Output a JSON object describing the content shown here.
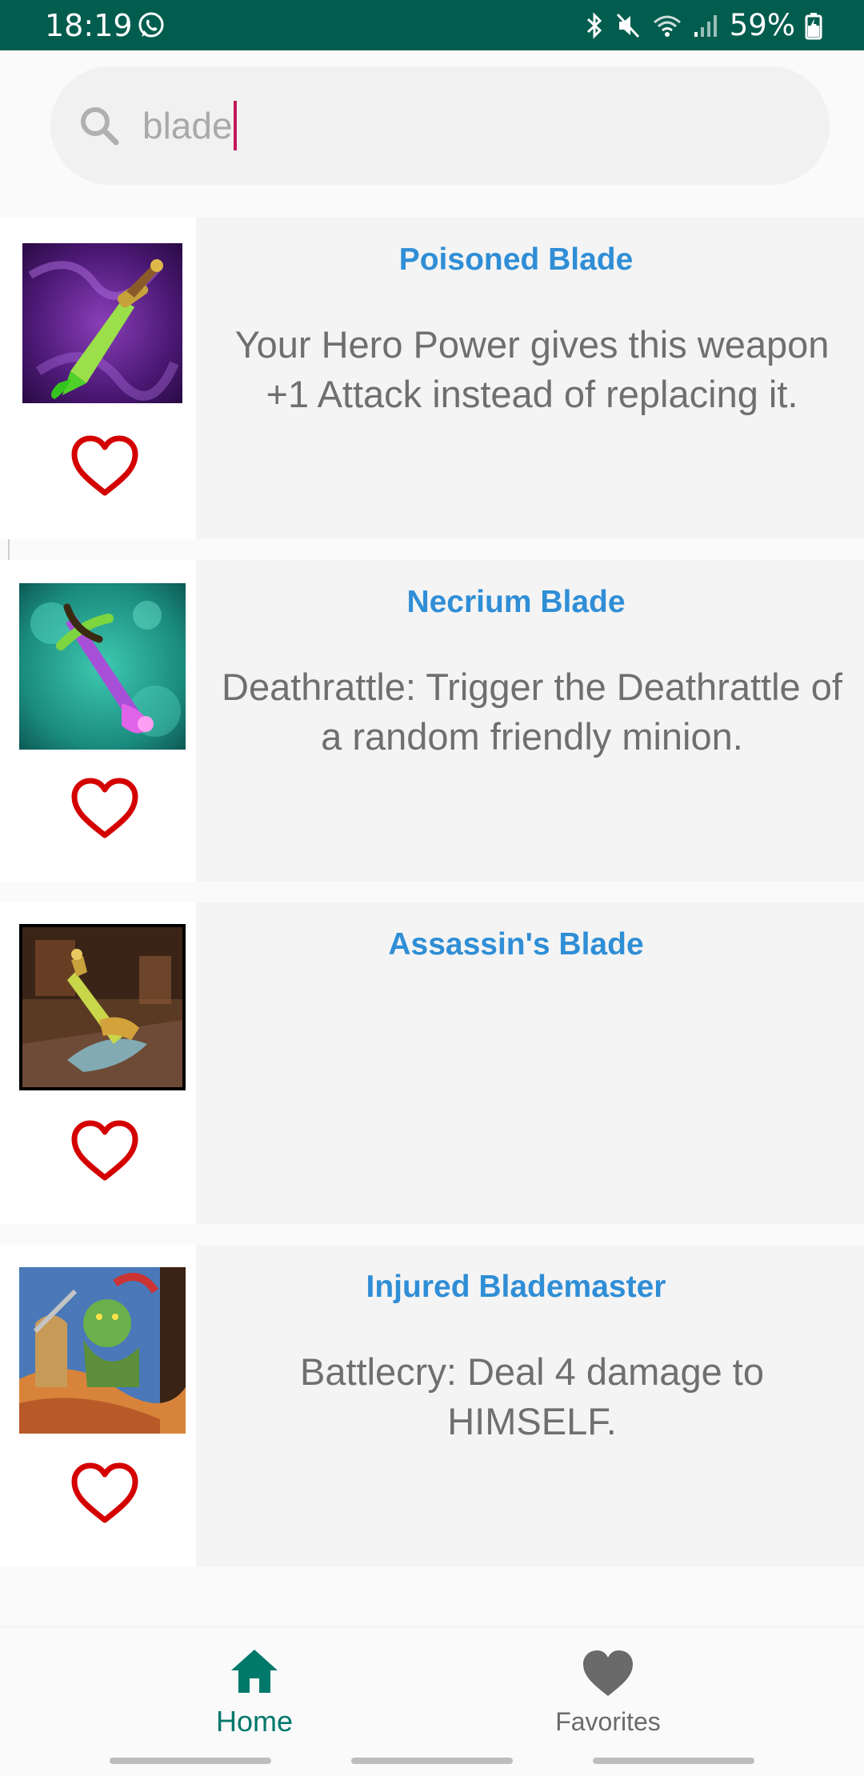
{
  "status_bar": {
    "time": "18:19",
    "battery": "59%",
    "color": "#025d4e"
  },
  "search": {
    "value": "blade",
    "placeholder": ""
  },
  "results": [
    {
      "title": "Poisoned Blade",
      "description": "Your Hero Power gives this weapon +1 Attack instead of replacing it.",
      "image": "poisoned-blade-art"
    },
    {
      "title": "Necrium Blade",
      "description": "Deathrattle:  Trigger the Deathrattle  of a random friendly minion.",
      "image": "necrium-blade-art"
    },
    {
      "title": "Assassin's Blade",
      "description": "",
      "image": "assassins-blade-art"
    },
    {
      "title": "Injured Blademaster",
      "description": "Battlecry:  Deal 4 damage to HIMSELF.",
      "image": "injured-blademaster-art"
    }
  ],
  "bottom_nav": {
    "home_label": "Home",
    "favorites_label": "Favorites",
    "active": "home",
    "active_color": "#00796b"
  },
  "icons": {
    "search": "search-icon",
    "favorite": "heart-outline-icon",
    "home": "home-icon",
    "favorites_tab": "heart-filled-icon"
  }
}
